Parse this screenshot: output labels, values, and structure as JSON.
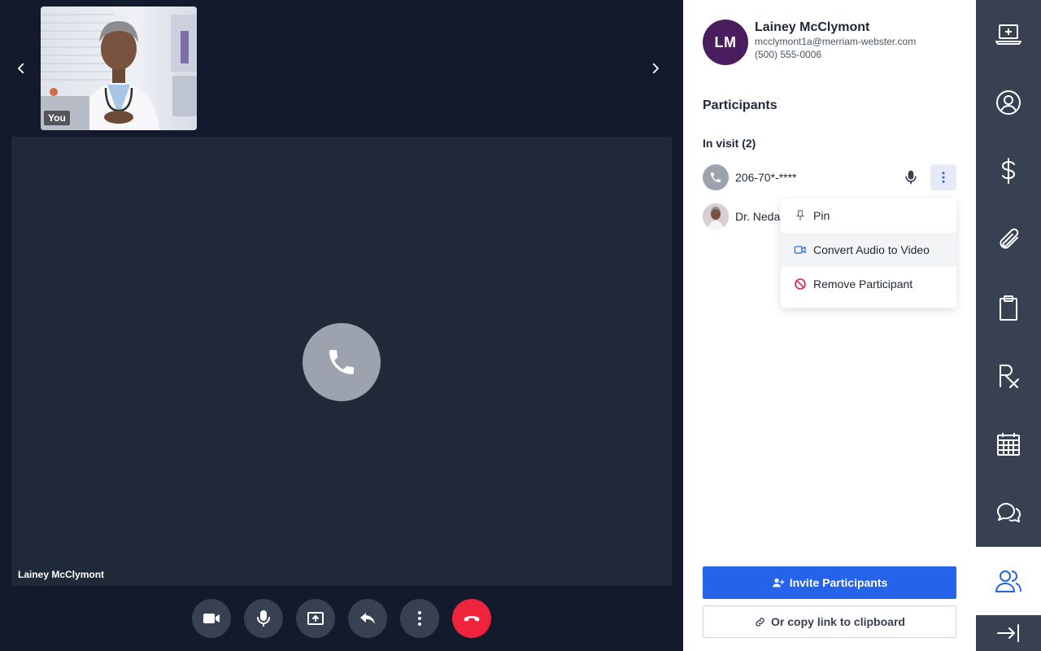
{
  "video": {
    "self_label": "You",
    "main_participant_name": "Lainey McClymont"
  },
  "controls": [
    {
      "name": "camera-button",
      "icon": "video-camera-icon"
    },
    {
      "name": "microphone-button",
      "icon": "microphone-icon"
    },
    {
      "name": "share-screen-button",
      "icon": "share-screen-icon"
    },
    {
      "name": "transfer-button",
      "icon": "reply-arrow-icon"
    },
    {
      "name": "more-options-button",
      "icon": "kebab-vertical-icon"
    },
    {
      "name": "end-call-button",
      "icon": "hang-up-icon"
    }
  ],
  "patient": {
    "initials": "LM",
    "name": "Lainey McClymont",
    "email": "mcclymont1a@merriam-webster.com",
    "phone": "(500) 555-0006"
  },
  "participants": {
    "title": "Participants",
    "in_visit_label": "In visit (2)",
    "list": [
      {
        "label": "206-70*-****",
        "type": "phone"
      },
      {
        "label": "Dr. Neda",
        "type": "video"
      }
    ]
  },
  "menu": {
    "items": [
      {
        "label": "Pin",
        "icon": "pin-icon"
      },
      {
        "label": "Convert Audio to Video",
        "icon": "video-camera-icon"
      },
      {
        "label": "Remove Participant",
        "icon": "block-icon"
      }
    ]
  },
  "actions": {
    "invite_label": "Invite Participants",
    "copy_label": "Or copy link to clipboard"
  },
  "rail": {
    "items": [
      "laptop-medical-icon",
      "user-circle-icon",
      "dollar-icon",
      "paperclip-icon",
      "clipboard-icon",
      "rx-icon",
      "calendar-icon",
      "chat-icon",
      "users-icon",
      "collapse-panel-icon"
    ],
    "active": "users-icon"
  },
  "colors": {
    "accent": "#2563eb",
    "end_call": "#ef233c",
    "avatar": "#4a1d5e",
    "remove": "#e11d48"
  }
}
